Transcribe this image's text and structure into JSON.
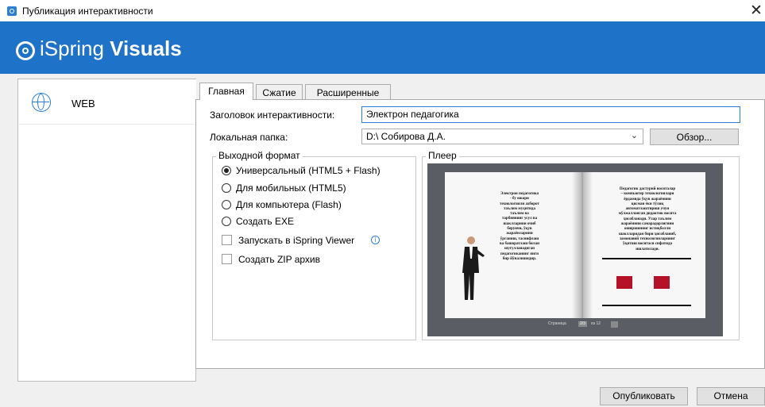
{
  "window": {
    "title": "Публикация интерактивности",
    "close_glyph": "✕"
  },
  "banner": {
    "brand_prefix": "iSpring ",
    "brand_bold": "Visuals",
    "logo_icon": "ispring-logo-icon"
  },
  "sidebar": {
    "items": [
      {
        "label": "WEB",
        "icon": "globe-icon"
      }
    ]
  },
  "tabs": [
    {
      "label": "Главная",
      "active": true
    },
    {
      "label": "Сжатие"
    },
    {
      "label": "Расширенные"
    }
  ],
  "form": {
    "title_label": "Заголовок интерактивности:",
    "title_value": "Электрон педагогика",
    "folder_label": "Локальная папка:",
    "folder_value": "D:\\ Собирова Д.А.",
    "browse_label": "Обзор..."
  },
  "output_format": {
    "title": "Выходной формат",
    "options": [
      {
        "label": "Универсальный (HTML5 + Flash)",
        "checked": true
      },
      {
        "label": "Для мобильных (HTML5)",
        "checked": false
      },
      {
        "label": "Для компьютера (Flash)",
        "checked": false
      },
      {
        "label": "Создать EXE",
        "checked": false
      }
    ],
    "checkboxes": [
      {
        "label": "Запускать в iSpring Viewer",
        "checked": false,
        "info_icon": "info-icon"
      },
      {
        "label": "Создать ZIP архив",
        "checked": false
      }
    ]
  },
  "player": {
    "title": "Плеер",
    "left_page_text": "Электрон педагогика\n- бу юкори\nтехнологияли ахборот\nтаълим муҳитида\nтаълим ва\nтарбиянинг усул ва\nшаклларини очиб\nберувчи, ўқув\nжараёнларини\nўрганиш, таснифлаш\nва башоратлаш билан\nшуғулланадиган\nпедагогиканинг янги\nбир йўналишидир.",
    "right_page_text": "Педагогик дастурий воситалар\n– компьютер технологиялари\nёрдамида ўқув жараёнини\nқисман ёки тўлиқ\nавтоматлаштириш учун\nмўлжалланган дидактик восита\nҳисобланади. Улар таълим\nжараёнини самарадорлигини\nоширишнинг истиқболли\nшаклларидан бири ҳисобланиб,\nзамонавий технологияларнинг\nўқитиш воситаси сифатида\nишлатилади.",
    "pager_text": "Страница",
    "pager_page": "2/3",
    "pager_of": "из 12"
  },
  "footer": {
    "publish_label": "Опубликовать",
    "cancel_label": "Отмена"
  },
  "colors": {
    "brand_blue": "#1e72c8",
    "accent": "#2b7fd6"
  }
}
